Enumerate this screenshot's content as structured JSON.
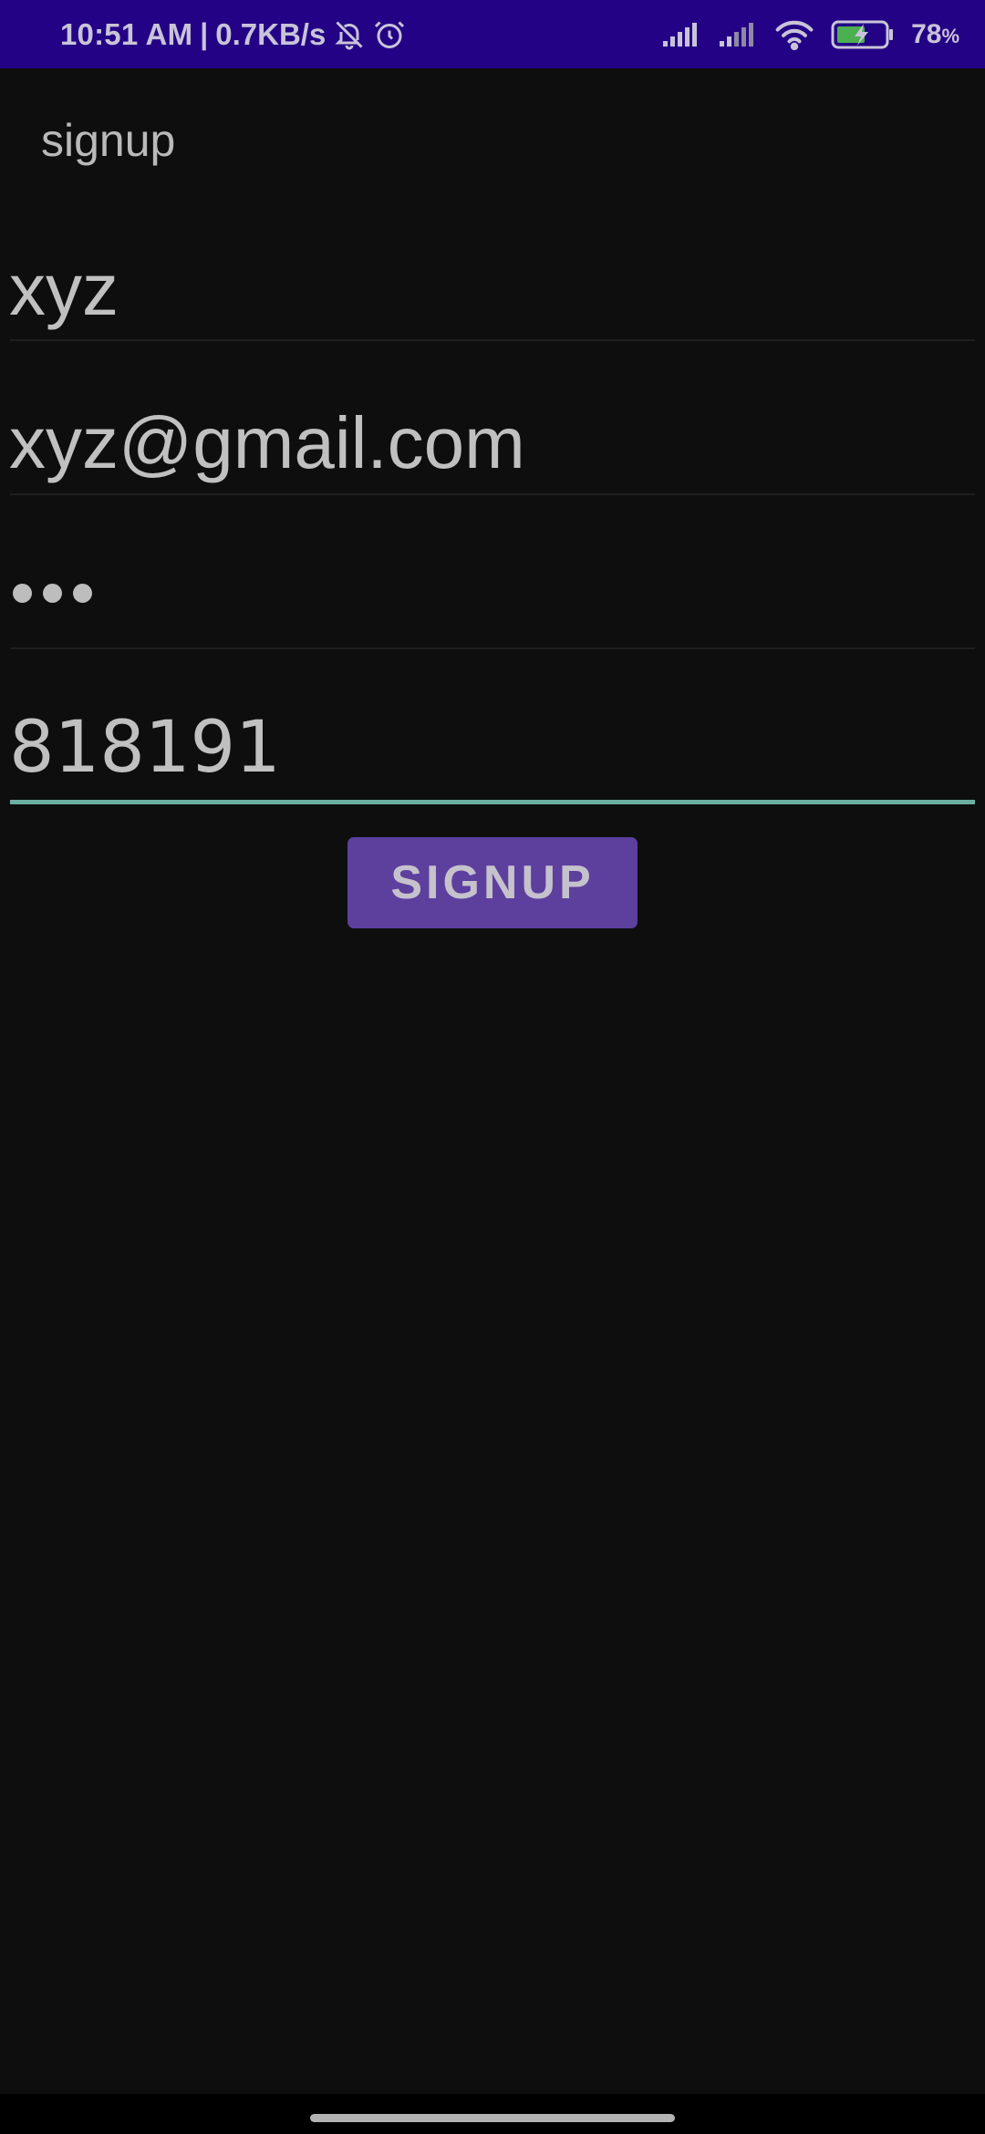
{
  "status_bar": {
    "time": "10:51 AM",
    "separator": "|",
    "speed": "0.7KB/s",
    "battery": "78",
    "battery_unit": "%",
    "icons": [
      "bell-off-icon",
      "alarm-icon",
      "signal-icon",
      "signal-icon",
      "wifi-icon",
      "battery-charging-icon"
    ]
  },
  "app": {
    "title": "signup"
  },
  "form": {
    "name_value": "xyz",
    "email_value": "xyz@gmail.com",
    "password_length": 3,
    "phone_value": "818191",
    "submit_label": "SIGNUP"
  },
  "colors": {
    "status_bar": "#230285",
    "background": "#0e0e0e",
    "accent_underline": "#6aafa0",
    "button": "#5d3f9e"
  }
}
